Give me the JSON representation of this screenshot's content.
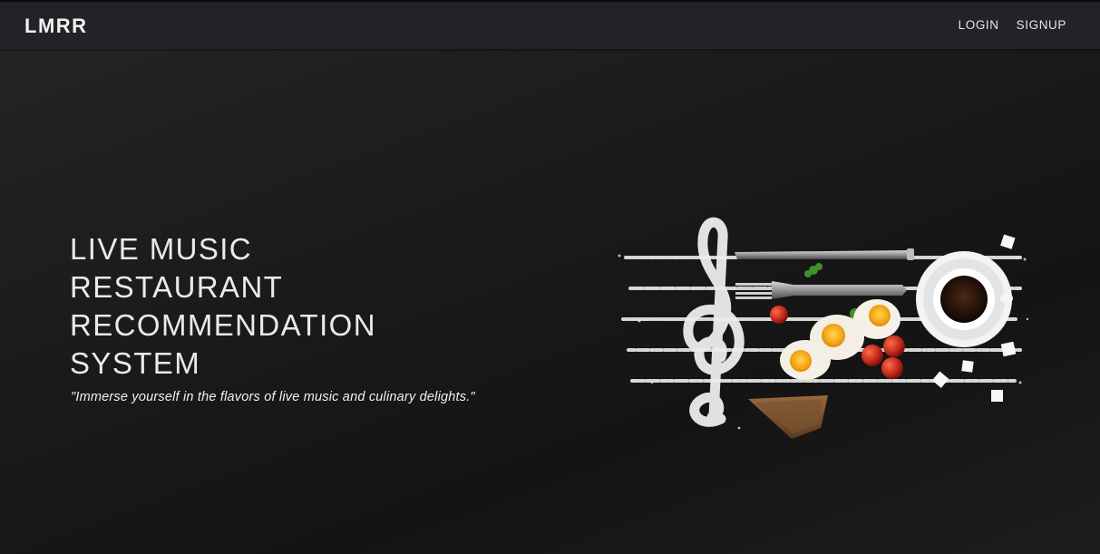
{
  "navbar": {
    "brand": "LMRR",
    "links": [
      {
        "label": "LOGIN"
      },
      {
        "label": "SIGNUP"
      }
    ]
  },
  "hero": {
    "title_lines": [
      "LIVE MUSIC",
      "RESTAURANT",
      "RECOMMENDATION",
      "SYSTEM"
    ],
    "tagline": "\"Immerse yourself in the flavors of live music and culinary delights.\"",
    "image": {
      "icon": "treble-clef-breakfast-illustration"
    }
  },
  "colors": {
    "navbar_bg": "#212326",
    "page_bg": "#1a1a1a",
    "text": "#eaeaea"
  }
}
